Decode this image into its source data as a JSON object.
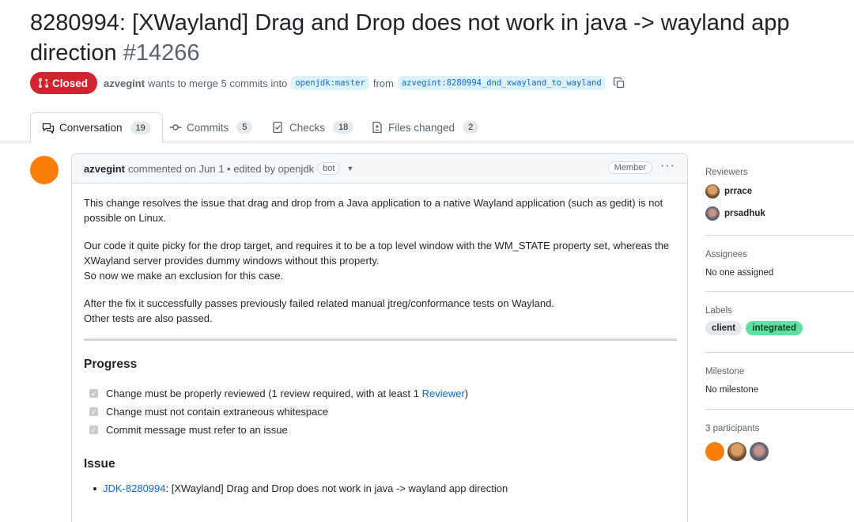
{
  "pr": {
    "title": "8280994: [XWayland] Drag and Drop does not work in java -> wayland app direction",
    "number": "#14266",
    "state": "Closed",
    "author": "azvegint",
    "merge_text": "wants to merge 5 commits into",
    "base_branch": "openjdk:master",
    "from_text": "from",
    "head_branch": "azvegint:8280994_dnd_xwayland_to_wayland"
  },
  "tabs": [
    {
      "label": "Conversation",
      "count": "19"
    },
    {
      "label": "Commits",
      "count": "5"
    },
    {
      "label": "Checks",
      "count": "18"
    },
    {
      "label": "Files changed",
      "count": "2"
    }
  ],
  "comment": {
    "author": "azvegint",
    "meta": "commented on Jun 1 • edited by openjdk",
    "bot_badge": "bot",
    "role": "Member",
    "paragraphs": [
      "This change resolves the issue that drag and drop from a Java application to a native Wayland application (such as gedit) is not possible on Linux.",
      "Our code it quite picky for the drop target, and requires it to be a top level window with the WM_STATE property set, whereas the XWayland server provides dummy windows without this property.",
      "So now we make an exclusion for this case.",
      "After the fix it successfully passes previously failed related manual jtreg/conformance tests on Wayland.",
      "Other tests are also passed."
    ],
    "progress_heading": "Progress",
    "tasks": [
      {
        "text": "Change must be properly reviewed (1 review required, with at least 1 ",
        "link": "Reviewer",
        "suffix": ")"
      },
      {
        "text": "Change must not contain extraneous whitespace"
      },
      {
        "text": "Commit message must refer to an issue"
      }
    ],
    "issue_heading": "Issue",
    "issue": {
      "link": "JDK-8280994",
      "text": ": [XWayland] Drag and Drop does not work in java -> wayland app direction"
    }
  },
  "sidebar": {
    "reviewers_title": "Reviewers",
    "reviewers": [
      "prrace",
      "prsadhuk"
    ],
    "assignees_title": "Assignees",
    "assignees_value": "No one assigned",
    "labels_title": "Labels",
    "labels": [
      {
        "name": "client",
        "bg": "#e6e9ec",
        "fg": "#1f2328"
      },
      {
        "name": "integrated",
        "bg": "#5fe0a0",
        "fg": "#0b3d22"
      }
    ],
    "milestone_title": "Milestone",
    "milestone_value": "No milestone",
    "participants_title": "3 participants"
  },
  "colors": {
    "closed": "#d1242f",
    "accent": "#0969da",
    "avatar_orange": "#fb7e09"
  }
}
